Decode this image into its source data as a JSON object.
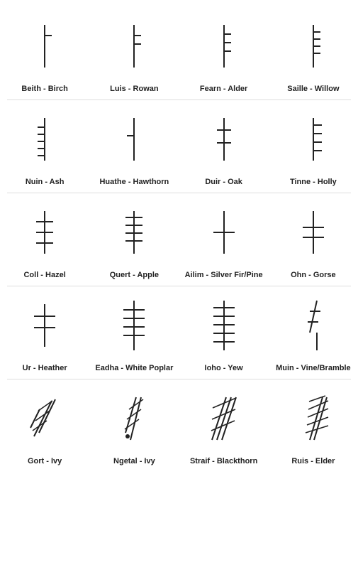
{
  "runes": [
    [
      {
        "id": "beith",
        "label": "Beith - Birch"
      },
      {
        "id": "luis",
        "label": "Luis - Rowan"
      },
      {
        "id": "fearn",
        "label": "Fearn - Alder"
      },
      {
        "id": "saille",
        "label": "Saille - Willow"
      }
    ],
    [
      {
        "id": "nuin",
        "label": "Nuin - Ash"
      },
      {
        "id": "huathe",
        "label": "Huathe - Hawthorn"
      },
      {
        "id": "duir",
        "label": "Duir - Oak"
      },
      {
        "id": "tinne",
        "label": "Tinne - Holly"
      }
    ],
    [
      {
        "id": "coll",
        "label": "Coll - Hazel"
      },
      {
        "id": "quert",
        "label": "Quert - Apple"
      },
      {
        "id": "ailim",
        "label": "Ailim - Silver Fir/Pine"
      },
      {
        "id": "ohn",
        "label": "Ohn - Gorse"
      }
    ],
    [
      {
        "id": "ur",
        "label": "Ur - Heather"
      },
      {
        "id": "eadha",
        "label": "Eadha - White Poplar"
      },
      {
        "id": "ioho",
        "label": "Ioho - Yew"
      },
      {
        "id": "muin",
        "label": "Muin - Vine/Bramble"
      }
    ],
    [
      {
        "id": "gort",
        "label": "Gort - Ivy"
      },
      {
        "id": "ngetal",
        "label": "Ngetal - Ivy"
      },
      {
        "id": "straif",
        "label": "Straif - Blackthorn"
      },
      {
        "id": "ruis",
        "label": "Ruis - Elder"
      }
    ]
  ]
}
